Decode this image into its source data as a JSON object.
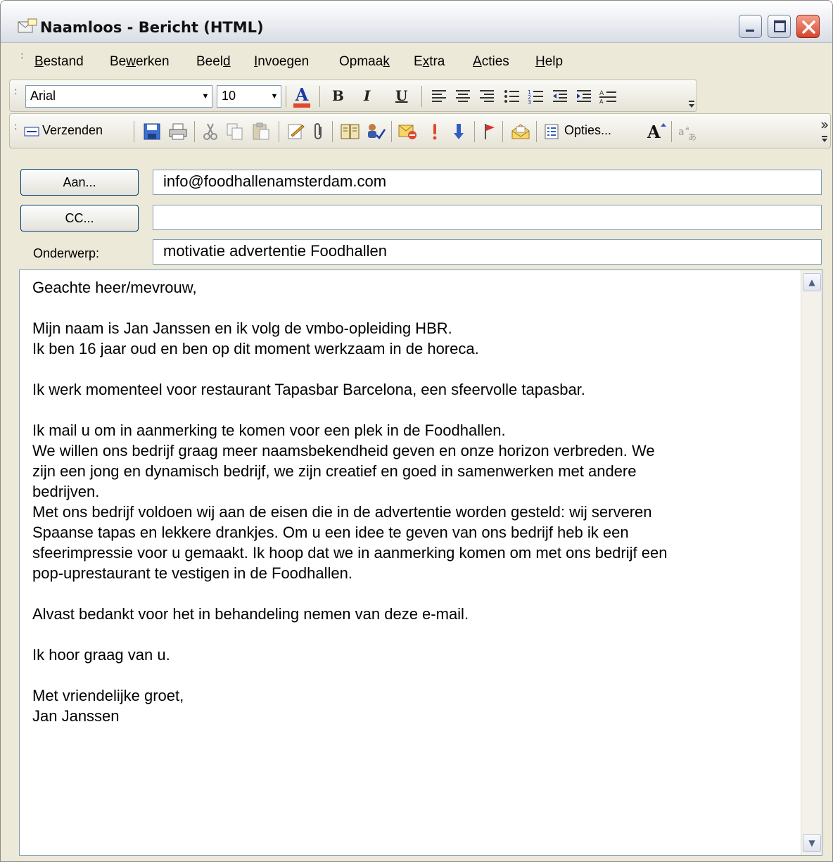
{
  "window": {
    "title": "Naamloos - Bericht (HTML)"
  },
  "menu": {
    "items": [
      {
        "label": "Bestand",
        "key": "B"
      },
      {
        "label": "Bewerken",
        "key": "w"
      },
      {
        "label": "Beeld",
        "key": "d"
      },
      {
        "label": "Invoegen",
        "key": "I"
      },
      {
        "label": "Opmaak",
        "key": "k"
      },
      {
        "label": "Extra",
        "key": "x"
      },
      {
        "label": "Acties",
        "key": "A"
      },
      {
        "label": "Help",
        "key": "H"
      }
    ]
  },
  "format_toolbar": {
    "font": "Arial",
    "size": "10",
    "font_color": "#e0492f",
    "icons": [
      "font-color-icon",
      "bold-icon",
      "italic-icon",
      "underline-icon",
      "align-left-icon",
      "align-center-icon",
      "align-right-icon",
      "bullets-icon",
      "numbering-icon",
      "decrease-indent-icon",
      "increase-indent-icon",
      "horizontal-line-icon",
      "toolbar-options-icon"
    ]
  },
  "standard_toolbar": {
    "send_label": "Verzenden",
    "options_label": "Opties...",
    "icons": [
      "send-icon",
      "save-icon",
      "print-icon",
      "cut-icon",
      "copy-icon",
      "paste-icon",
      "signature-icon",
      "attach-icon",
      "address-book-icon",
      "check-names-icon",
      "permission-icon",
      "importance-high-icon",
      "importance-low-icon",
      "flag-icon",
      "envelope-open-icon",
      "options-icon",
      "font-size-icon",
      "phonetic-icon",
      "toolbar-options-icon"
    ]
  },
  "header": {
    "to_button": "Aan...",
    "cc_button": "CC...",
    "subject_label": "Onderwerp:",
    "to_value": "info@foodhallenamsterdam.com",
    "cc_value": "",
    "subject_value": "motivatie advertentie Foodhallen"
  },
  "message": {
    "body": "Geachte heer/mevrouw,\n\nMijn naam is Jan Janssen en ik volg de vmbo-opleiding HBR.\nIk ben 16 jaar oud en ben op dit moment werkzaam in de horeca.\n\nIk werk momenteel voor restaurant Tapasbar Barcelona, een sfeervolle tapasbar.\n\nIk mail u om in aanmerking te komen voor een plek in de Foodhallen.\nWe willen ons bedrijf graag meer naamsbekendheid geven en onze horizon verbreden. We\nzijn een jong en dynamisch bedrijf, we zijn creatief en goed in samenwerken met andere\nbedrijven.\nMet ons bedrijf voldoen wij aan de eisen die in de advertentie worden gesteld: wij serveren\nSpaanse tapas en lekkere drankjes. Om u een idee te geven van ons bedrijf heb ik een\nsfeerimpressie voor u gemaakt. Ik hoop dat we in aanmerking komen om met ons bedrijf een\npop-uprestaurant te vestigen in de Foodhallen.\n\nAlvast bedankt voor het in behandeling nemen van deze e-mail.\n\nIk hoor graag van u.\n\nMet vriendelijke groet,\nJan Janssen"
  }
}
